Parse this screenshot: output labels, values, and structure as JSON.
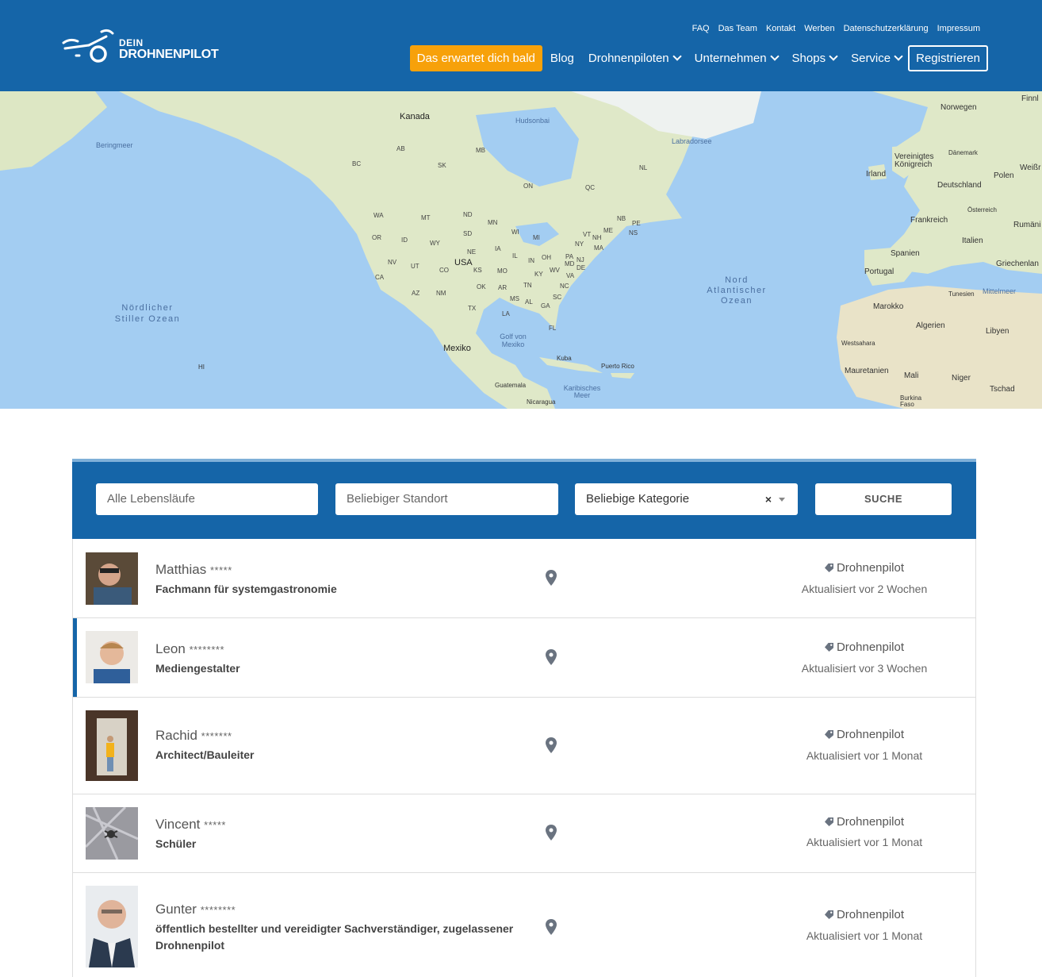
{
  "brand": {
    "line1": "DEIN",
    "line2": "DROHNENPILOT"
  },
  "top_links": [
    "FAQ",
    "Das Team",
    "Kontakt",
    "Werben",
    "Datenschutzerklärung",
    "Impressum"
  ],
  "main_nav": {
    "cta": "Das erwartet dich bald",
    "items": [
      "Blog",
      "Drohnenpiloten",
      "Unternehmen",
      "Shops",
      "Service"
    ],
    "register": "Registrieren"
  },
  "map": {
    "labels": {
      "kanada": "Kanada",
      "hudsonbai": "Hudsonbai",
      "labradorsee": "Labradorsee",
      "beringmeer": "Beringmeer",
      "usa": "USA",
      "mexiko": "Mexiko",
      "golf": "Golf von Mexiko",
      "kuba": "Kuba",
      "puertorico": "Puerto Rico",
      "guatemala": "Guatemala",
      "nicaragua": "Nicaragua",
      "karibik": "Karibisches Meer",
      "nordpazifik": "Nördlicher Stiller Ozean",
      "nordatlantik": "Nord Atlantischer Ozean",
      "norwegen": "Norwegen",
      "finnland": "Finnl",
      "daenemark": "Dänemark",
      "vk": "Vereinigtes Königreich",
      "irland": "Irland",
      "deutschland": "Deutschland",
      "polen": "Polen",
      "weiss": "Weißr",
      "oesterreich": "Österreich",
      "frankreich": "Frankreich",
      "rumaenien": "Rumäni",
      "italien": "Italien",
      "spanien": "Spanien",
      "portugal": "Portugal",
      "griechenland": "Griechenlan",
      "tunesien": "Tunesien",
      "mittelmeer": "Mittelmeer",
      "marokko": "Marokko",
      "algerien": "Algerien",
      "libyen": "Libyen",
      "westsahara": "Westsahara",
      "mauretanien": "Mauretanien",
      "mali": "Mali",
      "niger": "Niger",
      "tschad": "Tschad",
      "burkina": "Burkina Faso",
      "hi": "HI"
    },
    "states": [
      "AB",
      "MB",
      "BC",
      "SK",
      "ON",
      "QC",
      "NL",
      "WA",
      "MT",
      "ND",
      "MN",
      "OR",
      "ID",
      "SD",
      "WY",
      "WI",
      "MI",
      "NE",
      "IA",
      "NV",
      "UT",
      "IL",
      "OH",
      "CO",
      "KS",
      "MO",
      "IN",
      "KY",
      "WV",
      "VA",
      "CA",
      "AZ",
      "NM",
      "OK",
      "AR",
      "TN",
      "NC",
      "TX",
      "MS",
      "AL",
      "GA",
      "SC",
      "LA",
      "FL",
      "ME",
      "NB",
      "PE",
      "NS",
      "NH",
      "VT",
      "NY",
      "MA",
      "PA",
      "MD",
      "DE",
      "NJ"
    ]
  },
  "search": {
    "keywords_placeholder": "Alle Lebensläufe",
    "location_placeholder": "Beliebiger Standort",
    "category_value": "Beliebige Kategorie",
    "clear_symbol": "×",
    "button": "SUCHE"
  },
  "results": [
    {
      "name": "Matthias",
      "stars": "*****",
      "title": "Fachmann für systemgastronomie",
      "category": "Drohnenpilot",
      "updated": "Aktualisiert vor 2 Wochen"
    },
    {
      "name": "Leon",
      "stars": "********",
      "title": "Mediengestalter",
      "category": "Drohnenpilot",
      "updated": "Aktualisiert vor 3 Wochen"
    },
    {
      "name": "Rachid",
      "stars": "*******",
      "title": "Architect/Bauleiter",
      "category": "Drohnenpilot",
      "updated": "Aktualisiert vor 1 Monat"
    },
    {
      "name": "Vincent",
      "stars": "*****",
      "title": "Schüler",
      "category": "Drohnenpilot",
      "updated": "Aktualisiert vor 1 Monat"
    },
    {
      "name": "Gunter",
      "stars": "********",
      "title": "öffentlich bestellter und vereidigter Sachverständiger, zugelassener Drohnenpilot",
      "category": "Drohnenpilot",
      "updated": "Aktualisiert vor 1 Monat"
    }
  ],
  "colors": {
    "brand_blue": "#1565a8",
    "cta_orange": "#f7a10a",
    "water": "#a3cdf2",
    "land": "#dfe8c8"
  }
}
